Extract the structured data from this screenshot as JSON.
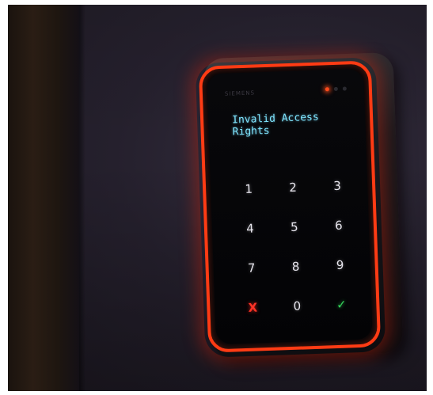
{
  "reader": {
    "brand": "SIEMENS",
    "display_message": "Invalid Access\nRights",
    "status_leds": [
      "on",
      "off",
      "off"
    ],
    "accent_color": "#ff3b14",
    "display_color": "#7fe6ff"
  },
  "keypad": {
    "keys": [
      {
        "label": "1",
        "kind": "digit"
      },
      {
        "label": "2",
        "kind": "digit"
      },
      {
        "label": "3",
        "kind": "digit"
      },
      {
        "label": "4",
        "kind": "digit"
      },
      {
        "label": "5",
        "kind": "digit"
      },
      {
        "label": "6",
        "kind": "digit"
      },
      {
        "label": "7",
        "kind": "digit"
      },
      {
        "label": "8",
        "kind": "digit"
      },
      {
        "label": "9",
        "kind": "digit"
      },
      {
        "label": "X",
        "kind": "cancel",
        "icon": "cancel-icon"
      },
      {
        "label": "0",
        "kind": "digit"
      },
      {
        "label": "✓",
        "kind": "ok",
        "icon": "checkmark-icon"
      }
    ]
  }
}
